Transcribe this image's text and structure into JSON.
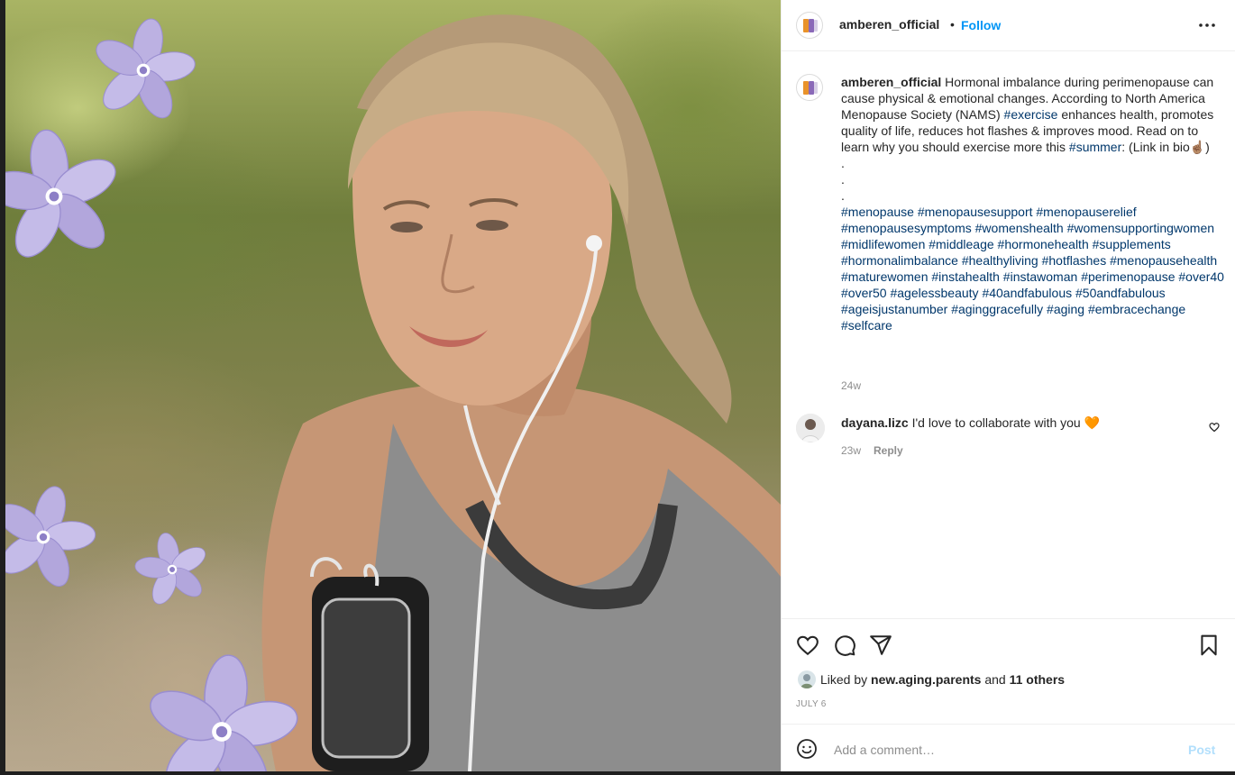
{
  "post": {
    "author": "amberen_official",
    "follow_label": "Follow",
    "separator": "•",
    "more_label": "More options"
  },
  "caption": {
    "author": "amberen_official",
    "segments": [
      {
        "t": "text",
        "v": " Hormonal imbalance during perimenopause can cause physical & emotional changes. According to North America Menopause Society (NAMS) "
      },
      {
        "t": "tag",
        "v": "#exercise"
      },
      {
        "t": "text",
        "v": " enhances health, promotes quality of life, reduces hot flashes & improves mood. Read on to learn why you should exercise more this "
      },
      {
        "t": "tag",
        "v": "#summer"
      },
      {
        "t": "text",
        "v": ": (Link in bio☝🏽)\n.\n.\n.\n"
      },
      {
        "t": "tag",
        "v": "#menopause"
      },
      {
        "t": "text",
        "v": " "
      },
      {
        "t": "tag",
        "v": "#menopausesupport"
      },
      {
        "t": "text",
        "v": " "
      },
      {
        "t": "tag",
        "v": "#menopauserelief"
      },
      {
        "t": "text",
        "v": " "
      },
      {
        "t": "tag",
        "v": "#menopausesymptoms"
      },
      {
        "t": "text",
        "v": " "
      },
      {
        "t": "tag",
        "v": "#womenshealth"
      },
      {
        "t": "text",
        "v": " "
      },
      {
        "t": "tag",
        "v": "#womensupportingwomen"
      },
      {
        "t": "text",
        "v": " "
      },
      {
        "t": "tag",
        "v": "#midlifewomen"
      },
      {
        "t": "text",
        "v": " "
      },
      {
        "t": "tag",
        "v": "#middleage"
      },
      {
        "t": "text",
        "v": " "
      },
      {
        "t": "tag",
        "v": "#hormonehealth"
      },
      {
        "t": "text",
        "v": " "
      },
      {
        "t": "tag",
        "v": "#supplements"
      },
      {
        "t": "text",
        "v": " "
      },
      {
        "t": "tag",
        "v": "#hormonalimbalance"
      },
      {
        "t": "text",
        "v": " "
      },
      {
        "t": "tag",
        "v": "#healthyliving"
      },
      {
        "t": "text",
        "v": " "
      },
      {
        "t": "tag",
        "v": "#hotflashes"
      },
      {
        "t": "text",
        "v": " "
      },
      {
        "t": "tag",
        "v": "#menopausehealth"
      },
      {
        "t": "text",
        "v": " "
      },
      {
        "t": "tag",
        "v": "#maturewomen"
      },
      {
        "t": "text",
        "v": " "
      },
      {
        "t": "tag",
        "v": "#instahealth"
      },
      {
        "t": "text",
        "v": " "
      },
      {
        "t": "tag",
        "v": "#instawoman"
      },
      {
        "t": "text",
        "v": " "
      },
      {
        "t": "tag",
        "v": "#perimenopause"
      },
      {
        "t": "text",
        "v": " "
      },
      {
        "t": "tag",
        "v": "#over40"
      },
      {
        "t": "text",
        "v": " "
      },
      {
        "t": "tag",
        "v": "#over50"
      },
      {
        "t": "text",
        "v": " "
      },
      {
        "t": "tag",
        "v": "#agelessbeauty"
      },
      {
        "t": "text",
        "v": " "
      },
      {
        "t": "tag",
        "v": "#40andfabulous"
      },
      {
        "t": "text",
        "v": " "
      },
      {
        "t": "tag",
        "v": "#50andfabulous"
      },
      {
        "t": "text",
        "v": " "
      },
      {
        "t": "tag",
        "v": "#ageisjustanumber"
      },
      {
        "t": "text",
        "v": " "
      },
      {
        "t": "tag",
        "v": "#aginggracefully"
      },
      {
        "t": "text",
        "v": " "
      },
      {
        "t": "tag",
        "v": "#aging"
      },
      {
        "t": "text",
        "v": " "
      },
      {
        "t": "tag",
        "v": "#embracechange"
      },
      {
        "t": "text",
        "v": " "
      },
      {
        "t": "tag",
        "v": "#selfcare"
      }
    ],
    "age": "24w"
  },
  "comments": [
    {
      "author": "dayana.lizc",
      "text": " I'd love to collaborate with you 🧡",
      "age": "23w",
      "reply_label": "Reply"
    }
  ],
  "engagement": {
    "liked_prefix": "Liked by ",
    "liked_user": "new.aging.parents",
    "liked_and": " and ",
    "liked_others": "11 others",
    "date": "JULY 6"
  },
  "comment_box": {
    "placeholder": "Add a comment…",
    "post_label": "Post"
  },
  "colors": {
    "link_blue": "#0095f6",
    "hashtag": "#00376b",
    "flower": "#b9addf"
  }
}
